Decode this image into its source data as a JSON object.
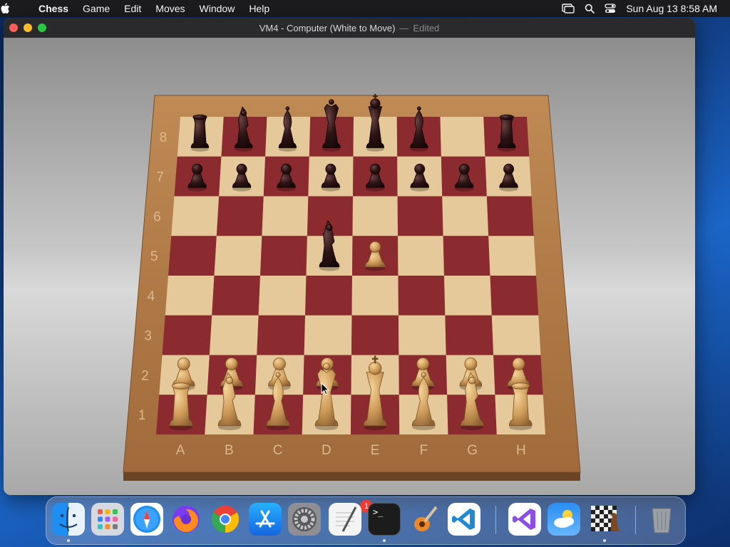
{
  "menubar": {
    "app_name": "Chess",
    "items": [
      "Game",
      "Edit",
      "Moves",
      "Window",
      "Help"
    ],
    "clock": "Sun Aug 13  8:58 AM"
  },
  "window": {
    "title": "VM4 - Computer   (White to Move)",
    "separator": "—",
    "edited": "Edited"
  },
  "board": {
    "files": [
      "A",
      "B",
      "C",
      "D",
      "E",
      "F",
      "G",
      "H"
    ],
    "ranks": [
      "8",
      "7",
      "6",
      "5",
      "4",
      "3",
      "2",
      "1"
    ],
    "pieces": [
      {
        "sq": "a8",
        "type": "rook",
        "color": "black"
      },
      {
        "sq": "b8",
        "type": "knight",
        "color": "black"
      },
      {
        "sq": "c8",
        "type": "bishop",
        "color": "black"
      },
      {
        "sq": "d8",
        "type": "queen",
        "color": "black"
      },
      {
        "sq": "e8",
        "type": "king",
        "color": "black"
      },
      {
        "sq": "f8",
        "type": "bishop",
        "color": "black"
      },
      {
        "sq": "h8",
        "type": "rook",
        "color": "black"
      },
      {
        "sq": "a7",
        "type": "pawn",
        "color": "black"
      },
      {
        "sq": "b7",
        "type": "pawn",
        "color": "black"
      },
      {
        "sq": "c7",
        "type": "pawn",
        "color": "black"
      },
      {
        "sq": "d7",
        "type": "pawn",
        "color": "black"
      },
      {
        "sq": "e7",
        "type": "pawn",
        "color": "black"
      },
      {
        "sq": "f7",
        "type": "pawn",
        "color": "black"
      },
      {
        "sq": "g7",
        "type": "pawn",
        "color": "black"
      },
      {
        "sq": "h7",
        "type": "pawn",
        "color": "black"
      },
      {
        "sq": "d5",
        "type": "knight",
        "color": "black"
      },
      {
        "sq": "e5",
        "type": "pawn",
        "color": "white"
      },
      {
        "sq": "a2",
        "type": "pawn",
        "color": "white"
      },
      {
        "sq": "b2",
        "type": "pawn",
        "color": "white"
      },
      {
        "sq": "c2",
        "type": "pawn",
        "color": "white"
      },
      {
        "sq": "d2",
        "type": "pawn",
        "color": "white"
      },
      {
        "sq": "f2",
        "type": "pawn",
        "color": "white"
      },
      {
        "sq": "g2",
        "type": "pawn",
        "color": "white"
      },
      {
        "sq": "h2",
        "type": "pawn",
        "color": "white"
      },
      {
        "sq": "a1",
        "type": "rook",
        "color": "white"
      },
      {
        "sq": "b1",
        "type": "knight",
        "color": "white"
      },
      {
        "sq": "c1",
        "type": "bishop",
        "color": "white"
      },
      {
        "sq": "d1",
        "type": "queen",
        "color": "white"
      },
      {
        "sq": "e1",
        "type": "king",
        "color": "white"
      },
      {
        "sq": "f1",
        "type": "bishop",
        "color": "white"
      },
      {
        "sq": "g1",
        "type": "knight",
        "color": "white"
      },
      {
        "sq": "h1",
        "type": "rook",
        "color": "white"
      }
    ],
    "colors": {
      "light_square": "#e6c99a",
      "dark_square": "#8b2b2f",
      "frame": "#b8834f",
      "black_piece": "#2a1212",
      "white_piece": "#d9aa66"
    }
  },
  "dock": {
    "apps": [
      {
        "name": "finder-icon"
      },
      {
        "name": "launchpad-icon"
      },
      {
        "name": "safari-icon"
      },
      {
        "name": "firefox-icon"
      },
      {
        "name": "chrome-icon"
      },
      {
        "name": "app-store-icon"
      },
      {
        "name": "system-settings-icon",
        "badge": "1"
      },
      {
        "name": "textedit-icon"
      },
      {
        "name": "terminal-icon"
      },
      {
        "name": "garageband-icon"
      },
      {
        "name": "vscode-icon"
      },
      {
        "name": "visual-studio-icon"
      },
      {
        "name": "weather-icon"
      },
      {
        "name": "chess-icon"
      },
      {
        "name": "trash-icon"
      }
    ],
    "terminal_prompt": ">_"
  }
}
